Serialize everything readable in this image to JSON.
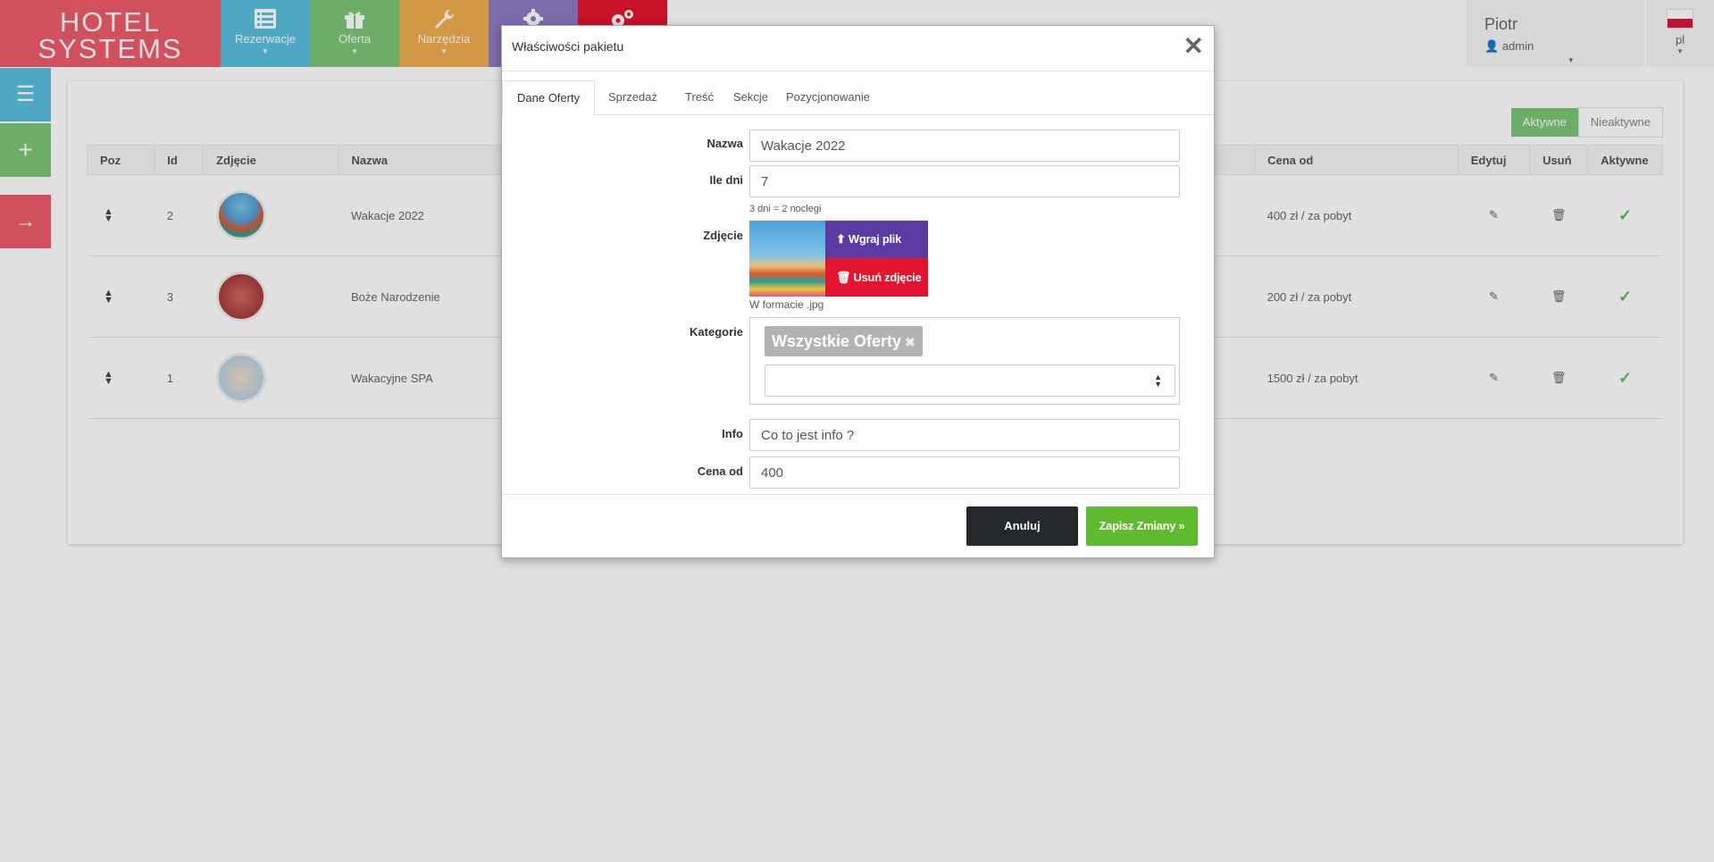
{
  "logo": {
    "line1": "HOTEL",
    "line2": "SYSTEMS"
  },
  "nav": [
    {
      "label": "Rezerwacje",
      "color": "#5bc0de",
      "icon": "list-icon"
    },
    {
      "label": "Oferta",
      "color": "#7cc576",
      "icon": "gift-icon"
    },
    {
      "label": "Narzędzia",
      "color": "#f0ad4e",
      "icon": "wrench-icon"
    },
    {
      "label": "",
      "color": "#8e7cc3",
      "icon": "gear-icon"
    },
    {
      "label": "",
      "color": "#e5142e",
      "icon": "gears-icon"
    }
  ],
  "user": {
    "name": "Piotr",
    "role": "admin"
  },
  "lang": {
    "code": "pl"
  },
  "filters": {
    "active": "Aktywne",
    "inactive": "Nieaktywne"
  },
  "table": {
    "headers": [
      "Poz",
      "Id",
      "Zdjęcie",
      "Nazwa",
      "Cena od",
      "Edytuj",
      "Usuń",
      "Aktywne"
    ],
    "rows": [
      {
        "id": "2",
        "name": "Wakacje 2022",
        "price": "400 zł / za pobyt"
      },
      {
        "id": "3",
        "name": "Boże Narodzenie",
        "price": "200 zł / za pobyt"
      },
      {
        "id": "1",
        "name": "Wakacyjne SPA",
        "price": "1500 zł / za pobyt"
      }
    ]
  },
  "modal": {
    "title": "Właściwości pakietu",
    "tabs": [
      "Dane Oferty",
      "Sprzedaż",
      "Treść",
      "Sekcje",
      "Pozycjonowanie"
    ],
    "fields": {
      "name_label": "Nazwa",
      "name_value": "Wakacje 2022",
      "days_label": "Ile dni",
      "days_value": "7",
      "days_hint": "3 dni = 2 noclegi",
      "photo_label": "Zdjęcie",
      "upload": "Wgraj plik",
      "remove": "Usuń zdjęcie",
      "photo_hint": "W formacie .jpg",
      "cat_label": "Kategorie",
      "cat_chip": "Wszystkie Oferty",
      "info_label": "Info",
      "info_value": "Co to jest info ?",
      "price_label": "Cena od",
      "price_value": "400"
    },
    "footer": {
      "cancel": "Anuluj",
      "save": "Zapisz Zmiany »"
    }
  },
  "colors": {
    "accent_green": "#5fbb2e",
    "danger": "#e5142e",
    "purple": "#5b3ba3",
    "logo": "#ef5b69"
  }
}
